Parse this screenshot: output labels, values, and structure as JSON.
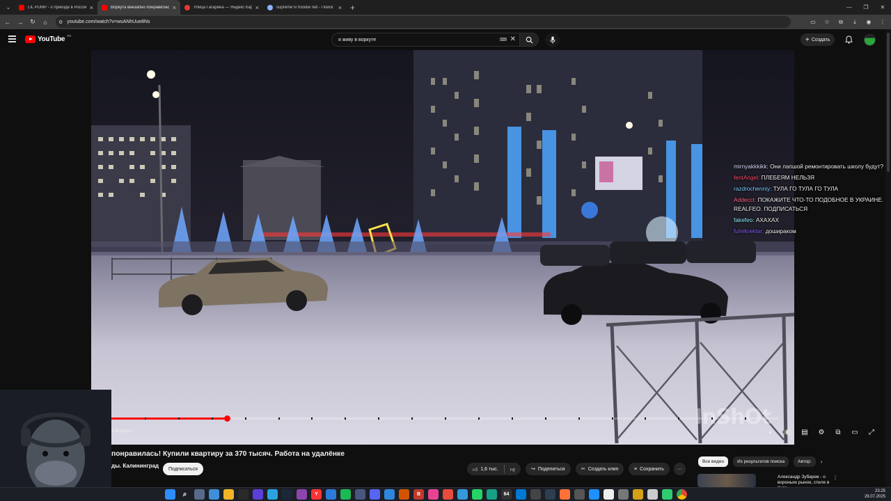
{
  "browser": {
    "tabs": [
      {
        "title": "LIL PUMP - о приезде в Россию",
        "favicon_color": "#ff0000"
      },
      {
        "title": "Воркута внезапно понравилась",
        "favicon_color": "#ff0000"
      },
      {
        "title": "Улица Гагарина — Яндекс Карты",
        "favicon_color": "#e53935"
      },
      {
        "title": "supreme lv hoodie red - Поиск",
        "favicon_color": "#8ab4f8"
      }
    ],
    "new_tab": "+",
    "url": "youtube.com/watch?v=wsANhUue8Ns"
  },
  "youtube": {
    "logo_text": "YouTube",
    "country_code": "RE",
    "search_query": "я живу в воркуте",
    "create_label": "Создать"
  },
  "chat": [
    {
      "user": "mirnyakkkikk:",
      "text": " Они лапшой ремонтировать школу будут?",
      "color": "#dcdcff"
    },
    {
      "user": "fentAngel:",
      "text": " ПЛЕБЕЯМ НЕЛЬЗЯ",
      "color": "#ff4f6d"
    },
    {
      "user": "razdrochenniy:",
      "text": " ТУЛА ГО ТУЛА ГО ТУЛА",
      "color": "#7fd3ff"
    },
    {
      "user": "Addecct:",
      "text": " ПОКАЖИТЕ ЧТО-ТО ПОДОБНОЕ В УКРАИНЕ. REALFEO. ПОДПИСАТЬСЯ",
      "color": "#ff6b8a"
    },
    {
      "user": "fakefeo:",
      "text": " АХАХАХ",
      "color": "#8ef0ff"
    },
    {
      "user": "fufelkrektar:",
      "text": " дошираком",
      "color": "#8a5cf6"
    }
  ],
  "player": {
    "watermark": "InShOt",
    "chapter": "и Воркута",
    "progress_fraction": 0.173
  },
  "video": {
    "title": "понравилась! Купили квартиру за 370 тысяч. Работа на удалёнке",
    "channel": "ды. Калининград",
    "subscribe_label": "Подписаться",
    "likes": "1,6 тыс.",
    "share_label": "Поделиться",
    "clip_label": "Создать клип",
    "save_label": "Сохранить",
    "more_label": "···"
  },
  "sidebar": {
    "chips": [
      "Все видео",
      "Из результатов поиска",
      "Автор: "
    ],
    "rec_title": "Александр Зубарев - о вороньих рынок, стиле в Кита...",
    "rec_more": "⋮"
  },
  "taskbar": {
    "time": "23:25",
    "date": "29.07.2025",
    "badge": "64"
  }
}
